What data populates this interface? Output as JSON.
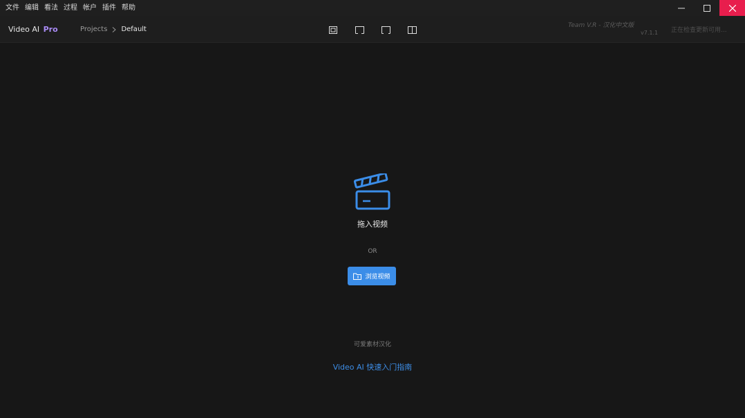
{
  "menubar": {
    "items": [
      "文件",
      "编辑",
      "看法",
      "过程",
      "帐户",
      "插件",
      "帮助"
    ]
  },
  "window_controls": {
    "minimize_icon": "minimize-icon",
    "maximize_icon": "maximize-icon",
    "close_icon": "close-icon",
    "close_color": "#e81e4d"
  },
  "toolbar": {
    "brand_name": "Video AI",
    "brand_badge": "Pro",
    "brand_badge_color": "#a98bf5",
    "breadcrumb": {
      "root": "Projects",
      "current": "Default"
    },
    "view_modes": [
      "single-view-icon",
      "preview-view-icon",
      "compare-view-icon",
      "split-view-icon"
    ],
    "team_text": "Team V.R - 汉化中文版",
    "version_text": "v7.1.1",
    "update_text": "正在检查更新可用..."
  },
  "main": {
    "drop_icon": "clapperboard-icon",
    "accent_color": "#3b8de8",
    "drop_label": "拖入视频",
    "or_label": "OR",
    "browse_button_label": "浏览视频",
    "browse_icon": "folder-icon",
    "credit_label": "可爱素材汉化",
    "guide_link": "Video AI 快速入门指南"
  }
}
